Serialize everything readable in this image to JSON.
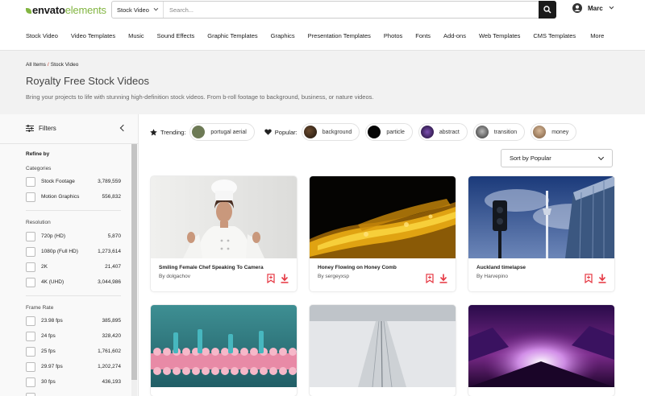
{
  "header": {
    "logo_bold": "envato",
    "logo_light": "elements",
    "category": "Stock Video",
    "search_placeholder": "Search...",
    "user_name": "Marc"
  },
  "nav": [
    "Stock Video",
    "Video Templates",
    "Music",
    "Sound Effects",
    "Graphic Templates",
    "Graphics",
    "Presentation Templates",
    "Photos",
    "Fonts",
    "Add-ons",
    "Web Templates",
    "CMS Templates",
    "More"
  ],
  "hero": {
    "breadcrumb_root": "All Items",
    "breadcrumb_sep": "/",
    "breadcrumb_current": "Stock Video",
    "title": "Royalty Free Stock Videos",
    "description": "Bring your projects to life with stunning high-definition stock videos. From b-roll footage to background, business, or nature videos."
  },
  "sidebar": {
    "title": "Filters",
    "refine": "Refine by",
    "categories_title": "Categories",
    "categories": [
      {
        "label": "Stock Footage",
        "count": "3,789,559"
      },
      {
        "label": "Motion Graphics",
        "count": "556,832"
      }
    ],
    "resolution_title": "Resolution",
    "resolution": [
      {
        "label": "720p (HD)",
        "count": "5,870"
      },
      {
        "label": "1080p (Full HD)",
        "count": "1,273,614"
      },
      {
        "label": "2K",
        "count": "21,407"
      },
      {
        "label": "4K (UHD)",
        "count": "3,044,986"
      }
    ],
    "framerate_title": "Frame Rate",
    "framerate": [
      {
        "label": "23.98 fps",
        "count": "385,895"
      },
      {
        "label": "24 fps",
        "count": "328,420"
      },
      {
        "label": "25 fps",
        "count": "1,761,602"
      },
      {
        "label": "29.97 fps",
        "count": "1,202,274"
      },
      {
        "label": "30 fps",
        "count": "436,193"
      }
    ]
  },
  "trending": {
    "label": "Trending:",
    "items": [
      {
        "label": "portugal aerial",
        "color": "#6d7a55"
      }
    ]
  },
  "popular": {
    "label": "Popular:",
    "items": [
      {
        "label": "background",
        "color": "#2a1e14"
      },
      {
        "label": "particle",
        "color": "#050505"
      },
      {
        "label": "abstract",
        "color": "#3a1d55"
      },
      {
        "label": "transition",
        "color": "#4d4d4d"
      },
      {
        "label": "money",
        "color": "#a2815c"
      }
    ]
  },
  "sort": {
    "label": "Sort by Popular"
  },
  "cards": [
    {
      "title": "Smiling Female Chef Speaking To Camera",
      "author": "By dolgachov"
    },
    {
      "title": "Honey Flowing on Honey Comb",
      "author": "By sergeyxsp"
    },
    {
      "title": "Auckland timelapse",
      "author": "By Harvepino"
    }
  ],
  "colors": {
    "accent": "#82b541",
    "action_red": "#e5343f",
    "hero_bg": "#f2f2f2"
  }
}
